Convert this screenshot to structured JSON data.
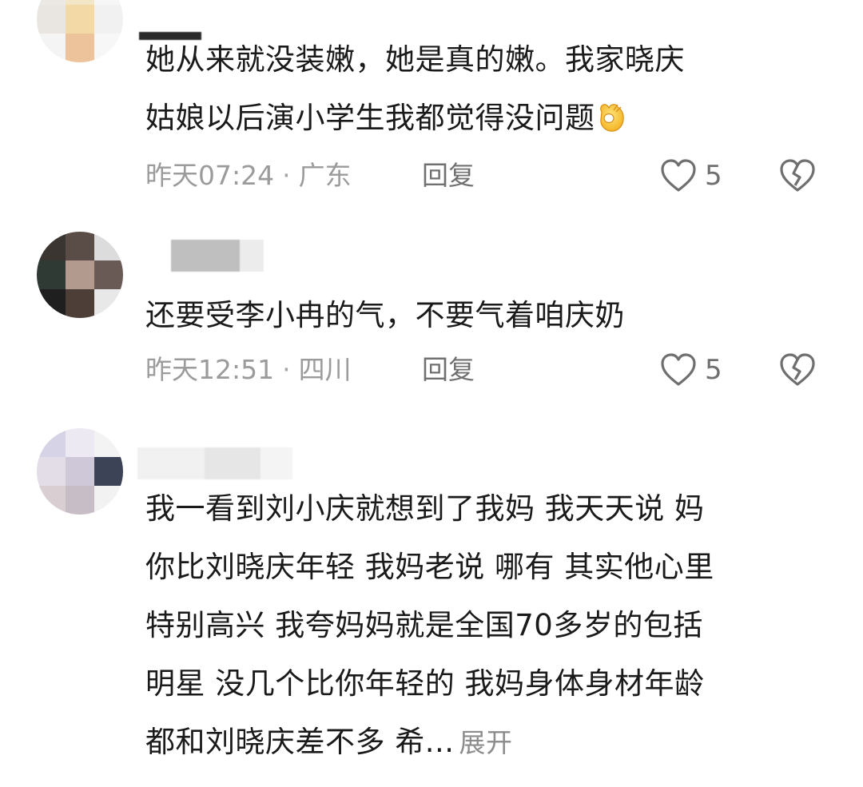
{
  "comments": [
    {
      "text_lines": [
        "她从来就没装嫩，她是真的嫩。我家晓庆",
        "姑娘以后演小学生我都觉得没问题"
      ],
      "emoji": "ok-hand-emoji",
      "time": "昨天07:24",
      "separator": "·",
      "location": "广东",
      "reply_label": "回复",
      "like_count": "5"
    },
    {
      "text_lines": [
        "还要受李小冉的气，不要气着咱庆奶"
      ],
      "time": "昨天12:51",
      "separator": "·",
      "location": "四川",
      "reply_label": "回复",
      "like_count": "5"
    },
    {
      "text_lines": [
        "我一看到刘小庆就想到了我妈 我天天说 妈",
        "你比刘晓庆年轻 我妈老说 哪有 其实他心里",
        "特别高兴 我夸妈妈就是全国70多岁的包括",
        "明星 没几个比你年轻的 我妈身体身材年龄",
        "都和刘晓庆差不多 希..."
      ],
      "expand_label": "展开"
    }
  ],
  "icons": {
    "like": "heart-outline-icon",
    "dislike": "broken-heart-icon"
  },
  "colors": {
    "text": "#1a1a1a",
    "meta": "#9b9b9b",
    "reply": "#707070",
    "icon": "#6f6f6f"
  }
}
